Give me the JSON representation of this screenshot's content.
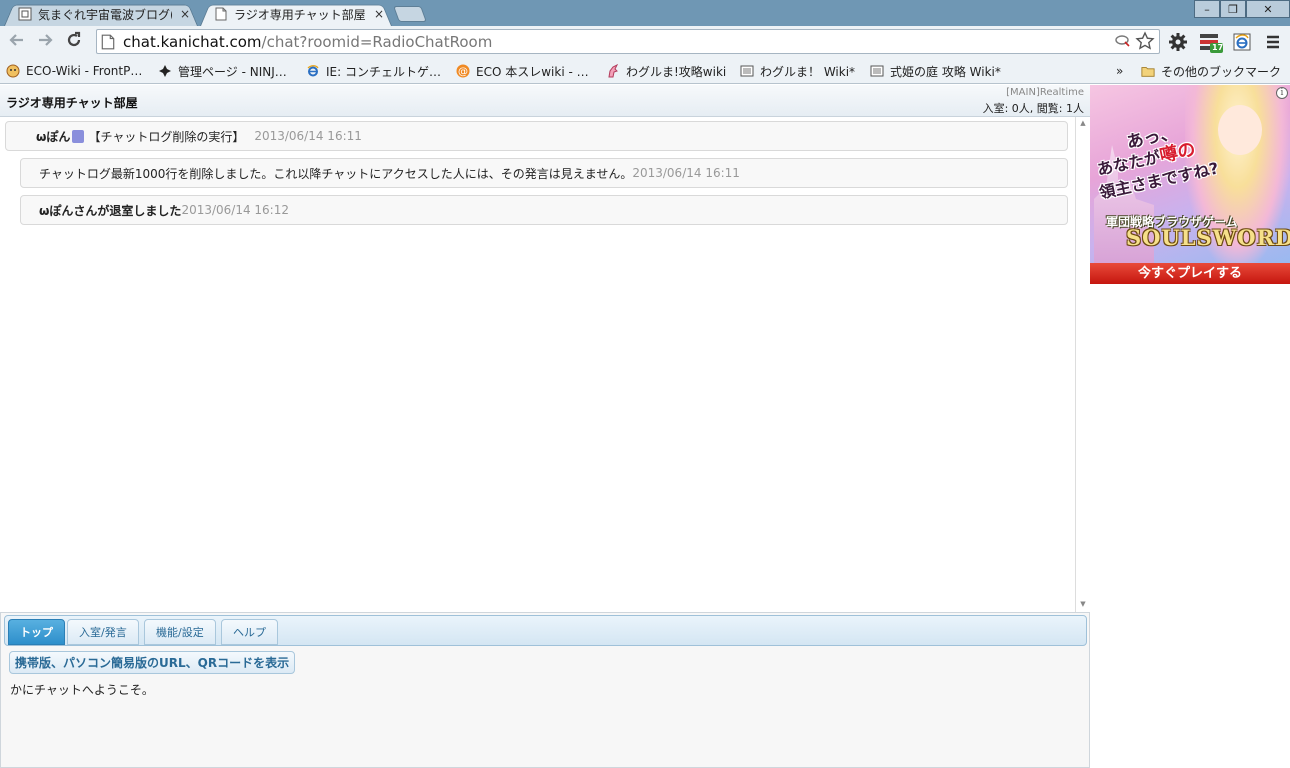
{
  "browser": {
    "tabs": [
      {
        "title": "気まぐれ宇宙電波ブログ(",
        "close": "×",
        "active": false
      },
      {
        "title": "ラジオ専用チャット部屋",
        "close": "×",
        "active": true
      }
    ],
    "window_controls": {
      "minimize": "–",
      "restore": "❐",
      "close": "✕"
    },
    "url": {
      "host": "chat.kanichat.com",
      "path": "/chat?roomid=RadioChatRoom"
    },
    "bookmarks": [
      {
        "label": "ECO-Wiki - FrontP…",
        "icon": "bookmark-favicon"
      },
      {
        "label": "管理ページ - NINJ…",
        "icon": "ninja-icon"
      },
      {
        "label": "IE: コンチェルトゲ…",
        "icon": "ie-icon"
      },
      {
        "label": "ECO 本スレwiki - …",
        "icon": "at-icon"
      },
      {
        "label": "わグルま!攻略wiki",
        "icon": "unicorn-icon"
      },
      {
        "label": "わグルま！ Wiki*",
        "icon": "wiki-icon"
      },
      {
        "label": "式姫の庭 攻略 Wiki*",
        "icon": "wiki-icon"
      }
    ],
    "bookmarks_overflow": "»",
    "other_bookmarks": "その他のブックマーク",
    "extension_badge": "17"
  },
  "room": {
    "title": "ラジオ専用チャット部屋",
    "mode": "[MAIN]Realtime",
    "counts": "入室: 0人, 閲覧: 1人"
  },
  "messages": [
    {
      "user": "ωぽん",
      "text": "【チャットログ削除の実行】",
      "time": "2013/06/14 16:11"
    },
    {
      "text": "チャットログ最新1000行を削除しました。これ以降チャットにアクセスした人には、その発言は見えません。",
      "time": "2013/06/14 16:11"
    },
    {
      "text": "ωぽんさんが退室しました",
      "time": "2013/06/14 16:12"
    }
  ],
  "panel": {
    "tabs": [
      "トップ",
      "入室/発言",
      "機能/設定",
      "ヘルプ"
    ],
    "active_tab": 0,
    "qr_button": "携帯版、パソコン簡易版のURL、QRコードを表示",
    "welcome": "かにチャットへようこそ。"
  },
  "ad": {
    "catch1": "あっ、",
    "catch2_pre": "あなたが",
    "catch2_red": "噂の",
    "catch3": "領主さまですね?",
    "subtitle": "軍団戦略ブラウザゲーム",
    "logo": "SOULSWORD",
    "cta": "今すぐプレイする",
    "info": "i"
  },
  "colors": {
    "tabstrip": "#6f97b4",
    "toolbar": "#edf2f6",
    "panel_tab_active": "#2e8fcb",
    "user_swatch": "#8a8fdc",
    "ad_cta": "#c5160f"
  }
}
